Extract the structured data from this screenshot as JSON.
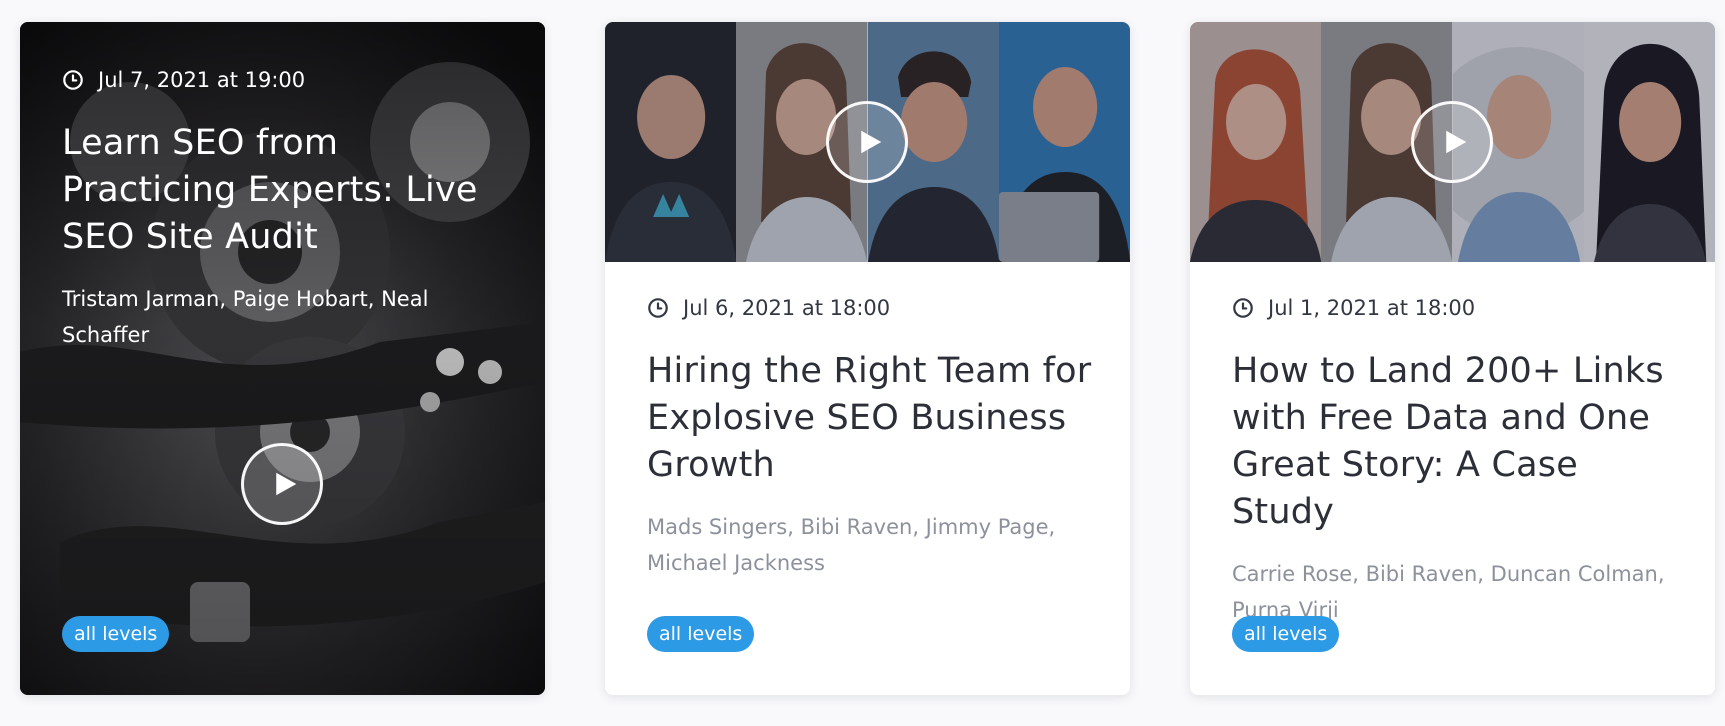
{
  "cards": [
    {
      "date": "Jul 7, 2021 at 19:00",
      "title": "Learn SEO from Practicing Experts: Live SEO Site Audit",
      "speakers": "Tristam Jarman, Paige Hobart, Neal Schaffer",
      "level": "all levels",
      "icon": "clock-icon",
      "media_icon": "play-icon"
    },
    {
      "date": "Jul 6, 2021 at 18:00",
      "title": "Hiring the Right Team for Explosive SEO Business Growth",
      "speakers": "Mads Singers, Bibi Raven, Jimmy Page, Michael Jackness",
      "level": "all levels",
      "icon": "clock-icon",
      "media_icon": "play-icon"
    },
    {
      "date": "Jul 1, 2021 at 18:00",
      "title": "How to Land 200+ Links with Free Data and One Great Story: A Case Study",
      "speakers": "Carrie Rose, Bibi Raven, Duncan Colman, Purna Virji",
      "level": "all levels",
      "icon": "clock-icon",
      "media_icon": "play-icon"
    }
  ],
  "colors": {
    "badge": "#2d9ae6",
    "title": "#2c2f38",
    "speakers": "#8d919c",
    "page_bg": "#f9f9fb"
  }
}
